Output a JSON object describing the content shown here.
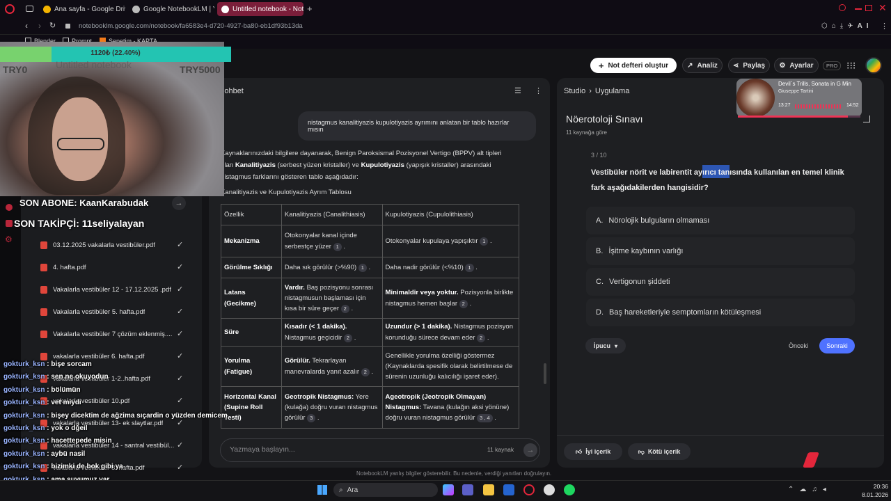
{
  "browser": {
    "tabs": [
      {
        "label": "Ana sayfa - Google Drive"
      },
      {
        "label": "Google NotebookLM | Yap"
      },
      {
        "label": "Untitled notebook - Notebo"
      }
    ],
    "url": "notebooklm.google.com/notebook/fa6583e4-d720-4927-ba80-eb1df93b13da",
    "bookmarks": [
      "Blender",
      "Prompt",
      "Sepetim - KAPTA..."
    ]
  },
  "overlay": {
    "progress_text": "1120₺ (22.40%)",
    "progress": 0.224,
    "try_left": "TRY0",
    "try_right": "TRY5000",
    "notebook_title": "Untitled notebook",
    "sub_line1": "SON ABONE: KaanKarabudak",
    "sub_line2": "SON TAKİPÇİ: 11seliyalayan"
  },
  "header": {
    "create_btn": "Not defteri oluştur",
    "analysis_btn": "Analiz",
    "share_btn": "Paylaş",
    "settings_btn": "Ayarlar",
    "pro_badge": "PRO"
  },
  "sources": [
    {
      "name": "03.12.2025 vakalarla vestibüler.pdf"
    },
    {
      "name": "4. hafta.pdf"
    },
    {
      "name": "Vakalarla vestibüler 12 - 17.12.2025 .pdf"
    },
    {
      "name": "Vakalarla vestibüler 5. hafta.pdf"
    },
    {
      "name": "Vakalarla vestibüler 7 çözüm eklenmiş...."
    },
    {
      "name": "vakalarla vestibüler 6. hafta.pdf"
    },
    {
      "name": "vakalarla vestibüler 1-2..hafta.pdf"
    },
    {
      "name": "vakalarla vestibüler 10.pdf"
    },
    {
      "name": "vakalarla vestibüler 13- ek slaytlar.pdf"
    },
    {
      "name": "vakalarla vestibüler 14 - santral vestibül..."
    },
    {
      "name": "vakalarla vestibüler 8. hafta.pdf"
    }
  ],
  "chat": {
    "header": "Sohbet",
    "user_message": "nistagmus kanalitiyazis kupulotiyazis ayrımını anlatan bir tablo hazırlar mısın",
    "intro_part1": "Kaynaklarınızdaki bilgilere dayanarak, Benign Paroksismal Pozisyonel Vertigo (BPPV) alt tipleri olan ",
    "intro_bold1": "Kanalitiyazis",
    "intro_part2": " (serbest yüzen kristaller) ve ",
    "intro_bold2": "Kupulotiyazis",
    "intro_part3": " (yapışık kristaller) arasındaki nistagmus farklarını gösteren tablo aşağıdadır:",
    "table_title": "Kanalitiyazis ve Kupulotiyazis Ayrım Tablosu",
    "col_headers": [
      "Özellik",
      "Kanalitiyazis (Canalithiasis)",
      "Kupulotiyazis (Cupulolithiasis)"
    ],
    "rows": [
      {
        "feature": "Mekanizma",
        "c1_bold": "",
        "c1": "Otokonyalar kanal içinde serbestçe yüzer",
        "c1_ref": "1",
        "c2_bold": "",
        "c2": "Otokonyalar kupulaya yapışıktır",
        "c2_ref": "1"
      },
      {
        "feature": "Görülme Sıklığı",
        "c1_bold": "",
        "c1": "Daha sık görülür (>%90)",
        "c1_ref": "1",
        "c2_bold": "",
        "c2": "Daha nadir görülür (<%10)",
        "c2_ref": "1"
      },
      {
        "feature": "Latans (Gecikme)",
        "c1_bold": "Vardır.",
        "c1": " Baş pozisyonu sonrası nistagmusun başlaması için kısa bir süre geçer",
        "c1_ref": "2",
        "c2_bold": "Minimaldir veya yoktur.",
        "c2": " Pozisyonla birlikte nistagmus hemen başlar",
        "c2_ref": "2"
      },
      {
        "feature": "Süre",
        "c1_bold": "Kısadır (< 1 dakika).",
        "c1": " Nistagmus geçicidir",
        "c1_ref": "2",
        "c2_bold": "Uzundur (> 1 dakika).",
        "c2": " Nistagmus pozisyon korunduğu sürece devam eder",
        "c2_ref": "2"
      },
      {
        "feature": "Yorulma (Fatigue)",
        "c1_bold": "Görülür.",
        "c1": " Tekrarlayan manevralarda yanıt azalır",
        "c1_ref": "2",
        "c2_bold": "",
        "c2": "Genellikle yorulma özelliği göstermez (Kaynaklarda spesifik olarak belirtilmese de sürenin uzunluğu kalıcılığı işaret eder).",
        "c2_ref": ""
      },
      {
        "feature": "Horizontal Kanal (Supine Roll Testi)",
        "c1_bold": "Geotropik Nistagmus:",
        "c1": " Yere (kulağa) doğru vuran nistagmus görülür",
        "c1_ref": "3",
        "c2_bold": "Ageotropik (Jeotropik Olmayan) Nistagmus:",
        "c2": " Tavana (kulağın aksi yönüne) doğru vuran nistagmus görülür",
        "c2_ref": "3 , 4"
      }
    ],
    "input_placeholder": "Yazmaya başlayın...",
    "source_count": "11 kaynak",
    "disclaimer": "NotebookLM yanlış bilgiler gösterebilir. Bu nedenle, verdiği yanıtları doğrulayın."
  },
  "studio": {
    "breadcrumb_root": "Studio",
    "breadcrumb_current": "Uygulama",
    "quiz_title": "Nöerotoloji Sınavı",
    "quiz_sources": "11 kaynağa göre",
    "question_counter": "3 / 10",
    "question": "Vestibüler nörit ve labirentit ayırıcı tanısında kullanılan en temel klinik fark aşağıdakilerden hangisidir?",
    "options": [
      {
        "letter": "A.",
        "text": "Nörolojik bulguların olmaması"
      },
      {
        "letter": "B.",
        "text": "İşitme kaybının varlığı"
      },
      {
        "letter": "C.",
        "text": "Vertigonun şiddeti"
      },
      {
        "letter": "D.",
        "text": "Baş hareketleriyle semptomların kötüleşmesi"
      }
    ],
    "hint_btn": "İpucu",
    "prev_btn": "Önceki",
    "next_btn": "Sonraki",
    "good_btn": "İyi içerik",
    "bad_btn": "Kötü içerik"
  },
  "music": {
    "title": "Devil`s Trills, Sonata in G Min",
    "artist": "Giuseppe Tartini",
    "elapsed": "13:27",
    "total": "14:52",
    "progress": 0.9
  },
  "stream_chat": [
    {
      "user": "gokturk_ksn",
      "msg": "bişe sorcam"
    },
    {
      "user": "gokturk_ksn",
      "msg": "sen ne okuyodun"
    },
    {
      "user": "gokturk_ksn",
      "msg": "bölümün"
    },
    {
      "user": "gokturk_ksn",
      "msg": "vet miydi"
    },
    {
      "user": "gokturk_ksn",
      "msg": "bişey dicektim de ağzima sıçardin o yüzden demicem"
    },
    {
      "user": "gokturk_ksn",
      "msg": "yok o dğeil"
    },
    {
      "user": "gokturk_ksn",
      "msg": "hacettepede misin"
    },
    {
      "user": "gokturk_ksn",
      "msg": "aybü nasil"
    },
    {
      "user": "gokturk_ksn",
      "msg": "bizimki de bok gibi ya"
    },
    {
      "user": "gokturk_ksn",
      "msg": "ama suyumuz var"
    },
    {
      "user": "gokturk_ksn",
      "msg": "😍"
    }
  ],
  "taskbar": {
    "search": "Ara",
    "time": "20:36",
    "date": "8.01.2026"
  },
  "colors": {
    "accent": "#4f72ff",
    "tab_active": "#7b1e3a",
    "progress_green": "#1e8f7e",
    "highlight": "#2d56b3"
  }
}
